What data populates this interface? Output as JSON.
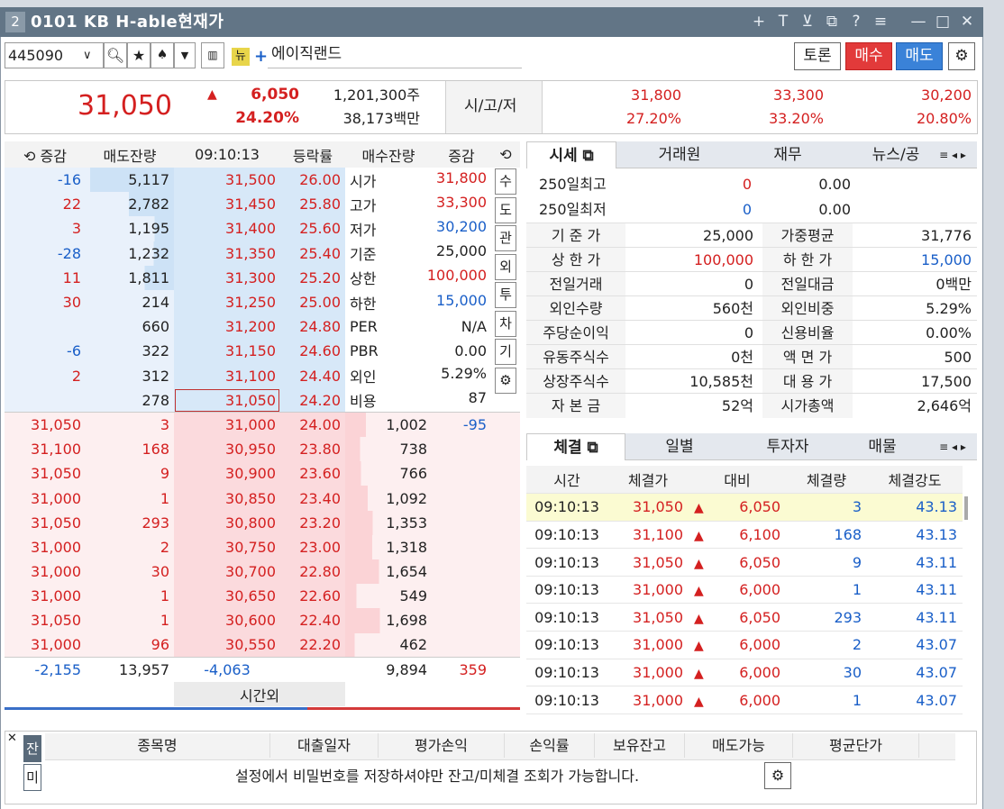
{
  "window": {
    "number": "2",
    "title": "0101 KB H-able현재가",
    "controls": [
      "+",
      "T",
      "⊻",
      "⧉",
      "?",
      "≡",
      "—",
      "□",
      "✕"
    ]
  },
  "toolbar": {
    "code": "445090",
    "stock_name": "에이직랜드",
    "badge": "뉴",
    "discuss": "토론",
    "buy": "매수",
    "sell": "매도"
  },
  "summary": {
    "price": "31,050",
    "arrow": "▲",
    "change": "6,050",
    "change_pct": "24.20%",
    "volume": "1,201,300주",
    "amount": "38,173백만",
    "sgj_label": "시/고/저",
    "open": "31,800",
    "high": "33,300",
    "low": "30,200",
    "open_pct": "27.20%",
    "high_pct": "33.20%",
    "low_pct": "20.80%"
  },
  "orderbook": {
    "headers": [
      "증감",
      "매도잔량",
      "09:10:13",
      "등락률",
      "매수잔량",
      "증감"
    ],
    "asks": [
      {
        "chg": "-16",
        "qty": "5,117",
        "price": "31,500",
        "rate": "26.00",
        "bar": 1.0
      },
      {
        "chg": "22",
        "qty": "2,782",
        "price": "31,450",
        "rate": "25.80",
        "bar": 0.54
      },
      {
        "chg": "3",
        "qty": "1,195",
        "price": "31,400",
        "rate": "25.60",
        "bar": 0.23
      },
      {
        "chg": "-28",
        "qty": "1,232",
        "price": "31,350",
        "rate": "25.40",
        "bar": 0.24
      },
      {
        "chg": "11",
        "qty": "1,811",
        "price": "31,300",
        "rate": "25.20",
        "bar": 0.35
      },
      {
        "chg": "30",
        "qty": "214",
        "price": "31,250",
        "rate": "25.00",
        "bar": 0
      },
      {
        "chg": "",
        "qty": "660",
        "price": "31,200",
        "rate": "24.80",
        "bar": 0
      },
      {
        "chg": "-6",
        "qty": "322",
        "price": "31,150",
        "rate": "24.60",
        "bar": 0
      },
      {
        "chg": "2",
        "qty": "312",
        "price": "31,100",
        "rate": "24.40",
        "bar": 0
      },
      {
        "chg": "",
        "qty": "278",
        "price": "31,050",
        "rate": "24.20",
        "bar": 0
      }
    ],
    "info": [
      {
        "label": "시가",
        "value": "31,800"
      },
      {
        "label": "고가",
        "value": "33,300"
      },
      {
        "label": "저가",
        "value": "30,200"
      },
      {
        "label": "기준",
        "value": "25,000"
      },
      {
        "label": "상한",
        "value": "100,000"
      },
      {
        "label": "하한",
        "value": "15,000"
      },
      {
        "label": "PER",
        "value": "N/A"
      },
      {
        "label": "PBR",
        "value": "0.00"
      },
      {
        "label": "외인",
        "value": "5.29%"
      },
      {
        "label": "비용",
        "value": "87"
      }
    ],
    "side_buttons": [
      "수",
      "도",
      "관",
      "외",
      "투",
      "차",
      "기",
      "⚙"
    ],
    "bids": [
      {
        "tp": "31,050",
        "tq": "3",
        "price": "31,000",
        "rate": "24.00",
        "qty": "1,002",
        "chg": "-95",
        "bar": 0.59
      },
      {
        "tp": "31,100",
        "tq": "168",
        "price": "30,950",
        "rate": "23.80",
        "qty": "738",
        "chg": "",
        "bar": 0.43
      },
      {
        "tp": "31,050",
        "tq": "9",
        "price": "30,900",
        "rate": "23.60",
        "qty": "766",
        "chg": "",
        "bar": 0.45
      },
      {
        "tp": "31,000",
        "tq": "1",
        "price": "30,850",
        "rate": "23.40",
        "qty": "1,092",
        "chg": "",
        "bar": 0.64
      },
      {
        "tp": "31,050",
        "tq": "293",
        "price": "30,800",
        "rate": "23.20",
        "qty": "1,353",
        "chg": "",
        "bar": 0.8
      },
      {
        "tp": "31,000",
        "tq": "2",
        "price": "30,750",
        "rate": "23.00",
        "qty": "1,318",
        "chg": "",
        "bar": 0.78
      },
      {
        "tp": "31,000",
        "tq": "30",
        "price": "30,700",
        "rate": "22.80",
        "qty": "1,654",
        "chg": "",
        "bar": 0.97
      },
      {
        "tp": "31,000",
        "tq": "1",
        "price": "30,650",
        "rate": "22.60",
        "qty": "549",
        "chg": "",
        "bar": 0.32
      },
      {
        "tp": "31,050",
        "tq": "1",
        "price": "30,600",
        "rate": "22.40",
        "qty": "1,698",
        "chg": "",
        "bar": 1.0
      },
      {
        "tp": "31,000",
        "tq": "96",
        "price": "30,550",
        "rate": "22.20",
        "qty": "462",
        "chg": "",
        "bar": 0.27
      }
    ],
    "totals": {
      "ask_chg": "-2,155",
      "ask_qty": "13,957",
      "net": "-4,063",
      "bid_qty": "9,894",
      "bid_chg": "359"
    },
    "after_hours": "시간외"
  },
  "market_tabs": [
    "시세",
    "거래원",
    "재무",
    "뉴스/공"
  ],
  "market": {
    "row1": {
      "label": "250일최고",
      "value": "0",
      "pct": "0.00"
    },
    "row2": {
      "label": "250일최저",
      "value": "0",
      "pct": "0.00"
    },
    "rows": [
      {
        "l1": "기 준 가",
        "v1": "25,000",
        "l2": "가중평균",
        "v2": "31,776"
      },
      {
        "l1": "상 한 가",
        "v1": "100,000",
        "l2": "하 한 가",
        "v2": "15,000"
      },
      {
        "l1": "전일거래",
        "v1": "0",
        "l2": "전일대금",
        "v2": "0백만"
      },
      {
        "l1": "외인수량",
        "v1": "560천",
        "l2": "외인비중",
        "v2": "5.29%"
      },
      {
        "l1": "주당순이익",
        "v1": "0",
        "l2": "신용비율",
        "v2": "0.00%"
      },
      {
        "l1": "유동주식수",
        "v1": "0천",
        "l2": "액 면 가",
        "v2": "500"
      },
      {
        "l1": "상장주식수",
        "v1": "10,585천",
        "l2": "대 용 가",
        "v2": "17,500"
      },
      {
        "l1": "자 본 금",
        "v1": "52억",
        "l2": "시가총액",
        "v2": "2,646억"
      }
    ]
  },
  "trade_tabs": [
    "체결",
    "일별",
    "투자자",
    "매물"
  ],
  "trades": {
    "headers": [
      "시간",
      "체결가",
      "대비",
      "체결량",
      "체결강도"
    ],
    "rows": [
      {
        "time": "09:10:13",
        "price": "31,050",
        "arrow": "▲",
        "chg": "6,050",
        "qty": "3",
        "power": "43.13"
      },
      {
        "time": "09:10:13",
        "price": "31,100",
        "arrow": "▲",
        "chg": "6,100",
        "qty": "168",
        "power": "43.13"
      },
      {
        "time": "09:10:13",
        "price": "31,050",
        "arrow": "▲",
        "chg": "6,050",
        "qty": "9",
        "power": "43.11"
      },
      {
        "time": "09:10:13",
        "price": "31,000",
        "arrow": "▲",
        "chg": "6,000",
        "qty": "1",
        "power": "43.11"
      },
      {
        "time": "09:10:13",
        "price": "31,050",
        "arrow": "▲",
        "chg": "6,050",
        "qty": "293",
        "power": "43.11"
      },
      {
        "time": "09:10:13",
        "price": "31,000",
        "arrow": "▲",
        "chg": "6,000",
        "qty": "2",
        "power": "43.07"
      },
      {
        "time": "09:10:13",
        "price": "31,000",
        "arrow": "▲",
        "chg": "6,000",
        "qty": "30",
        "power": "43.07"
      },
      {
        "time": "09:10:13",
        "price": "31,000",
        "arrow": "▲",
        "chg": "6,000",
        "qty": "1",
        "power": "43.07"
      }
    ]
  },
  "bottom": {
    "side_tabs": [
      "잔",
      "미"
    ],
    "headers": [
      "종목명",
      "대출일자",
      "평가손익",
      "손익률",
      "보유잔고",
      "매도가능",
      "평균단가"
    ],
    "message": "설정에서 비밀번호를 저장하셔야만 잔고/미체결 조회가 가능합니다."
  }
}
